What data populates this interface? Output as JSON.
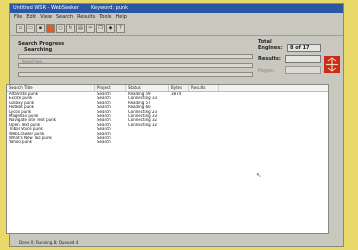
{
  "window": {
    "title": "Untitled WSR - WebSeeker",
    "keyword": "Keyword: punk"
  },
  "menu": [
    "File",
    "Edit",
    "View",
    "Search",
    "Results",
    "Tools",
    "Help"
  ],
  "toolbar": {
    "buttons": [
      "new-icon",
      "open-icon",
      "save-icon",
      "stop-icon",
      "search-icon",
      "refresh-icon",
      "print-icon",
      "cut-icon",
      "copy-icon",
      "options-icon",
      "help-icon"
    ]
  },
  "progress": {
    "heading": "Search Progress",
    "status": "Searching",
    "label": "Searching..."
  },
  "totals": {
    "heading": "Total",
    "engines_label": "Engines:",
    "engines_value": "8 of 17",
    "results_label": "Results:",
    "pages_label": "Pages:"
  },
  "table": {
    "columns": [
      "Search Title",
      "Project",
      "Status",
      "Bytes",
      "Results"
    ],
    "rows": [
      [
        "AltaVista punk",
        "Search",
        "Reading 59",
        "3874",
        ""
      ],
      [
        "Excite punk",
        "Search",
        "Connecting 33",
        "",
        ""
      ],
      [
        "Galaxy punk",
        "Search",
        "Reading 57",
        "",
        ""
      ],
      [
        "HotBot punk",
        "Search",
        "Reading 60",
        "",
        ""
      ],
      [
        "Lycos punk",
        "Search",
        "Connecting 23",
        "",
        ""
      ],
      [
        "Magellan punk",
        "Search",
        "Connecting 33",
        "",
        ""
      ],
      [
        "Navigate site Text punk",
        "Search",
        "Connecting 32",
        "",
        ""
      ],
      [
        "Open Text punk",
        "Search",
        "Connecting 32",
        "",
        ""
      ],
      [
        "Tribal Voice punk",
        "Search",
        "",
        "",
        ""
      ],
      [
        "WebCrawler punk",
        "Search",
        "",
        "",
        ""
      ],
      [
        "What's New Too punk",
        "Search",
        "",
        "",
        ""
      ],
      [
        "Yahoo punk",
        "Search",
        "",
        "",
        ""
      ]
    ]
  },
  "statusbar": {
    "text": "Done 0; Running 8; Queued 4"
  },
  "colors": {
    "titlebar": "#2c57a4",
    "stop_button": "#e15a2a",
    "logo": "#cc2a1c",
    "background": "#e9d96a"
  }
}
